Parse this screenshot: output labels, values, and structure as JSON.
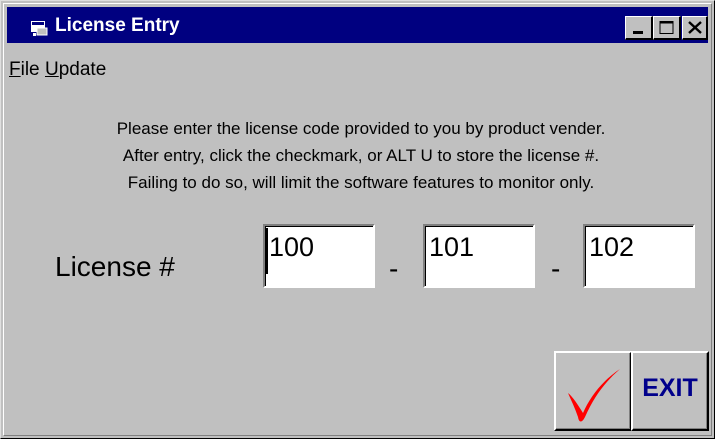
{
  "window": {
    "title": "License Entry"
  },
  "menu": {
    "file": {
      "accel": "F",
      "rest": "ile"
    },
    "update": {
      "accel": "U",
      "rest": "pdate"
    }
  },
  "instructions": [
    "Please enter the license code provided to you by product vender.",
    "After entry, click the checkmark, or ALT U to store the license #.",
    "Failing to do so, will limit the software features to monitor only."
  ],
  "license": {
    "label": "License #",
    "separator": "-",
    "segments": [
      "100",
      "101",
      "102"
    ]
  },
  "buttons": {
    "exit_label": "EXIT"
  },
  "colors": {
    "titlebar": "#000080",
    "face": "#c0c0c0",
    "checkmark": "#ff0000",
    "exit_text": "#00008b"
  },
  "icons": {
    "app": "app-icon",
    "minimize": "minimize-icon",
    "maximize": "maximize-icon",
    "close": "close-icon",
    "checkmark": "checkmark-icon"
  }
}
